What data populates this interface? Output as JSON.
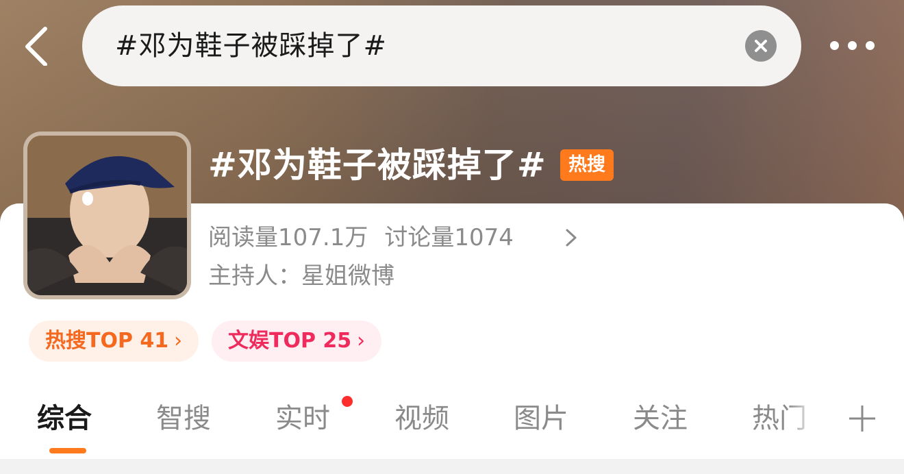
{
  "header": {
    "search_text": "#邓为鞋子被踩掉了#"
  },
  "topic": {
    "title": "#邓为鞋子被踩掉了#",
    "badge": "热搜",
    "read_label": "阅读量",
    "read_value": "107.1万",
    "discuss_label": "讨论量",
    "discuss_value": "1074",
    "host_label": "主持人：",
    "host_name": "星姐微博"
  },
  "rankings": [
    {
      "label": "热搜TOP 41",
      "chevron": "›"
    },
    {
      "label": "文娱TOP 25",
      "chevron": "›"
    }
  ],
  "tabs": [
    {
      "label": "综合",
      "active": true
    },
    {
      "label": "智搜"
    },
    {
      "label": "实时",
      "notification_dot": true
    },
    {
      "label": "视频"
    },
    {
      "label": "图片"
    },
    {
      "label": "关注"
    },
    {
      "label": "热门"
    }
  ],
  "colors": {
    "accent_orange": "#ff7a1c",
    "hot_pill_text": "#f4691f",
    "ent_pill_text": "#ee2b5c",
    "notification_red": "#ff2e2e",
    "secondary_text": "#8a8a8a"
  },
  "icons": {
    "back": "chevron-left-icon",
    "clear": "close-circle-icon",
    "more": "more-dots-icon",
    "stats_arrow": "chevron-right-icon",
    "add_tab": "plus-icon"
  }
}
